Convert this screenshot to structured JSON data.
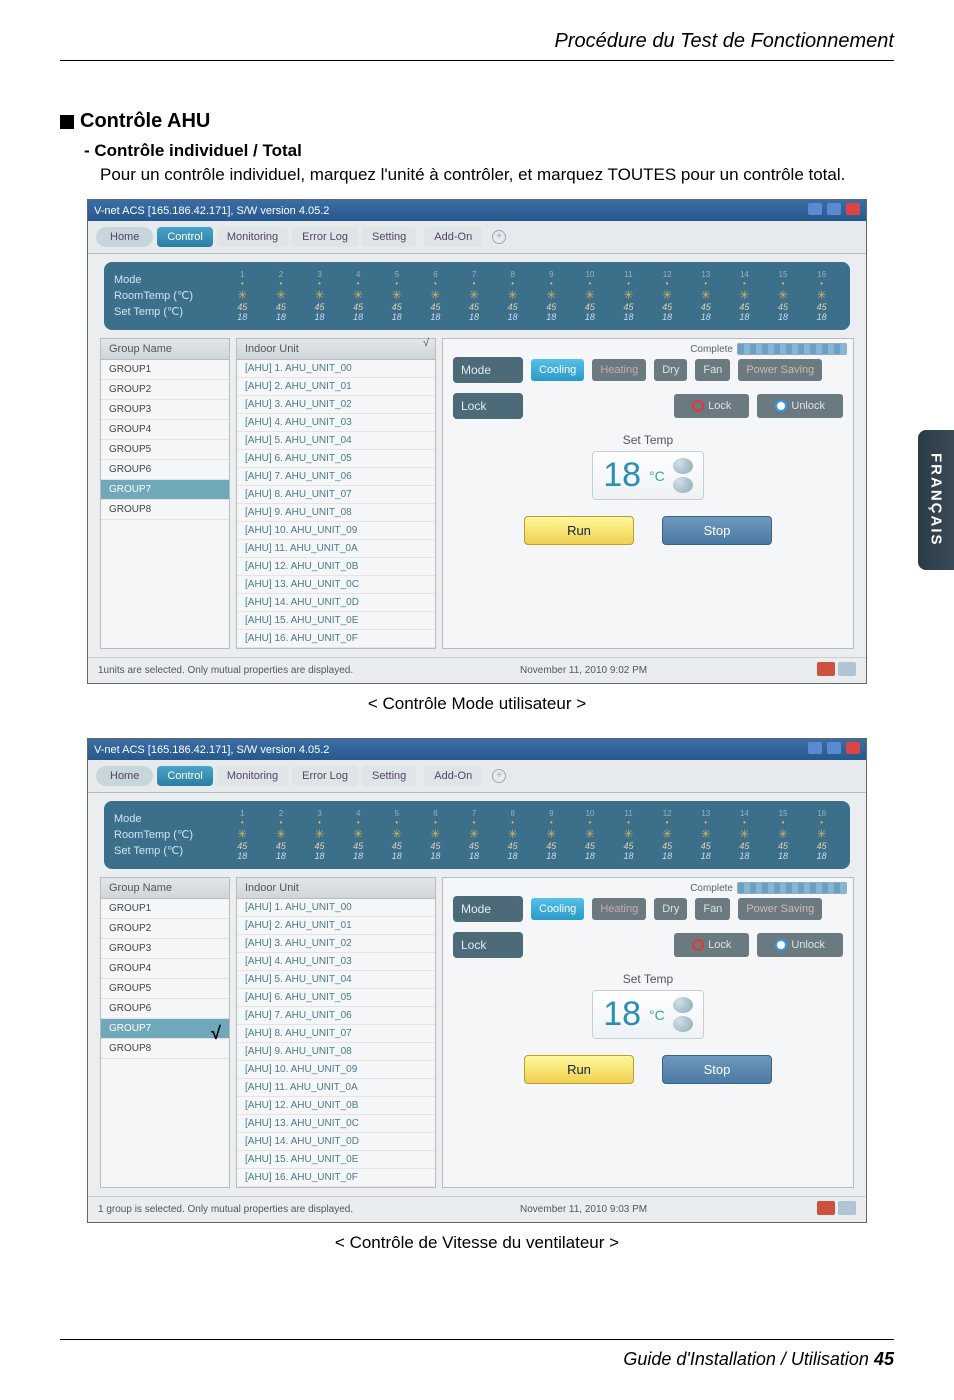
{
  "page": {
    "header": "Procédure du Test de Fonctionnement",
    "side_tab": "FRANÇAIS",
    "footer_label": "Guide d'Installation / Utilisation",
    "footer_page": "45"
  },
  "section": {
    "h1": "Contrôle AHU",
    "h2": "- Contrôle individuel / Total",
    "body": "Pour un contrôle individuel, marquez l'unité à contrôler, et marquez TOUTES pour un contrôle total.",
    "caption1": "< Contrôle Mode utilisateur >",
    "caption2": "< Contrôle de Vitesse du ventilateur >"
  },
  "app": {
    "title": "V-net ACS [165.186.42.171],   S/W version 4.05.2",
    "nav": {
      "home": "Home",
      "control": "Control",
      "monitoring": "Monitoring",
      "errorlog": "Error Log",
      "setting": "Setting",
      "addon": "Add-On"
    },
    "status_labels": {
      "mode": "Mode",
      "roomtemp": "RoomTemp (℃)",
      "settemp": "Set Temp  (℃)"
    },
    "status_cells": [
      1,
      2,
      3,
      4,
      5,
      6,
      7,
      8,
      9,
      10,
      11,
      12,
      13,
      14,
      15,
      16
    ],
    "status_rt": "45",
    "status_st": "18",
    "col_group": "Group Name",
    "col_unit": "Indoor Unit",
    "groups": [
      "GROUP1",
      "GROUP2",
      "GROUP3",
      "GROUP4",
      "GROUP5",
      "GROUP6",
      "GROUP7",
      "GROUP8"
    ],
    "units": [
      "[AHU] 1. AHU_UNIT_00",
      "[AHU] 2. AHU_UNIT_01",
      "[AHU] 3. AHU_UNIT_02",
      "[AHU] 4. AHU_UNIT_03",
      "[AHU] 5. AHU_UNIT_04",
      "[AHU] 6. AHU_UNIT_05",
      "[AHU] 7. AHU_UNIT_06",
      "[AHU] 8. AHU_UNIT_07",
      "[AHU] 9. AHU_UNIT_08",
      "[AHU] 10. AHU_UNIT_09",
      "[AHU] 11. AHU_UNIT_0A",
      "[AHU] 12. AHU_UNIT_0B",
      "[AHU] 13. AHU_UNIT_0C",
      "[AHU] 14. AHU_UNIT_0D",
      "[AHU] 15. AHU_UNIT_0E",
      "[AHU] 16. AHU_UNIT_0F"
    ],
    "complete": "Complete",
    "mode_label": "Mode",
    "modes": {
      "cooling": "Cooling",
      "heating": "Heating",
      "dry": "Dry",
      "fan": "Fan",
      "power": "Power Saving"
    },
    "lock_label": "Lock",
    "lock": "Lock",
    "unlock": "Unlock",
    "settemp_title": "Set Temp",
    "settemp_value": "18",
    "settemp_unit": "°C",
    "run": "Run",
    "stop": "Stop",
    "status1_left": "1units are selected. Only mutual properties are displayed.",
    "status1_right": "November 11, 2010  9:02 PM",
    "status2_left": "1 group is selected. Only mutual properties are displayed.",
    "status2_right": "November 11, 2010  9:03 PM"
  }
}
